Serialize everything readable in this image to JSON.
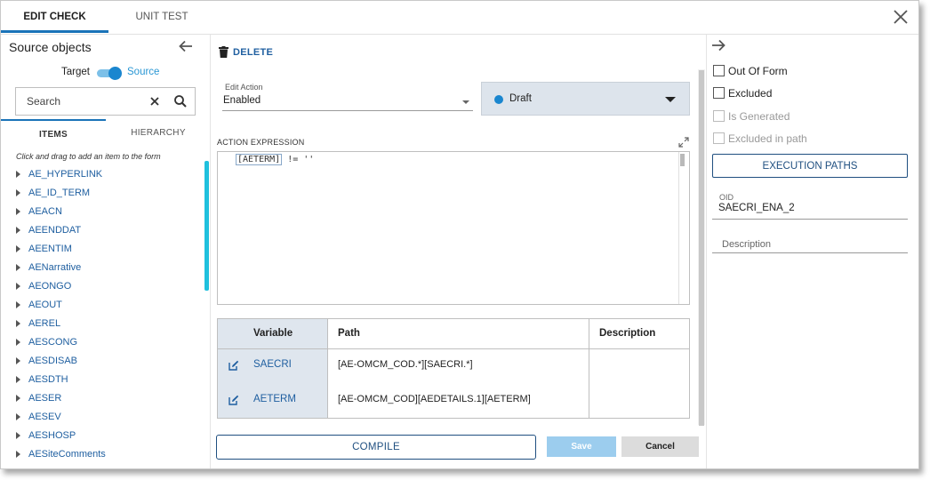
{
  "tabs": [
    {
      "label": "EDIT CHECK",
      "active": true
    },
    {
      "label": "UNIT TEST",
      "active": false
    }
  ],
  "left": {
    "title": "Source objects",
    "toggle": {
      "left_label": "Target",
      "right_label": "Source",
      "value": "Source"
    },
    "search": {
      "placeholder": "Search",
      "value": ""
    },
    "subtabs": [
      {
        "label": "ITEMS",
        "active": true
      },
      {
        "label": "HIERARCHY",
        "active": false
      }
    ],
    "hint": "Click and drag to add an item to the form",
    "items": [
      "AE_HYPERLINK",
      "AE_ID_TERM",
      "AEACN",
      "AEENDDAT",
      "AEENTIM",
      "AENarrative",
      "AEONGO",
      "AEOUT",
      "AEREL",
      "AESCONG",
      "AESDISAB",
      "AESDTH",
      "AESER",
      "AESEV",
      "AESHOSP",
      "AESiteComments"
    ]
  },
  "main": {
    "delete_label": "DELETE",
    "edit_action": {
      "label": "Edit Action",
      "value": "Enabled"
    },
    "status": {
      "value": "Draft",
      "color": "#1a86cf"
    },
    "expression": {
      "label": "ACTION EXPRESSION",
      "token": "[AETERM]",
      "rest": " != ''"
    },
    "variables": {
      "headers": {
        "variable": "Variable",
        "path": "Path",
        "description": "Description"
      },
      "rows": [
        {
          "name": "SAECRI",
          "path": "[AE-OMCM_COD.*][SAECRI.*]",
          "description": ""
        },
        {
          "name": "AETERM",
          "path": "[AE-OMCM_COD][AEDETAILS.1][AETERM]",
          "description": ""
        }
      ]
    },
    "compile_label": "COMPILE",
    "save_label": "Save",
    "cancel_label": "Cancel"
  },
  "right": {
    "checkboxes": [
      {
        "label": "Out Of Form",
        "checked": false,
        "disabled": false
      },
      {
        "label": "Excluded",
        "checked": false,
        "disabled": false
      },
      {
        "label": "Is Generated",
        "checked": false,
        "disabled": true
      },
      {
        "label": "Excluded in path",
        "checked": false,
        "disabled": true
      }
    ],
    "execution_paths_label": "EXECUTION PATHS",
    "oid": {
      "label": "OID",
      "value": "SAECRI_ENA_2"
    },
    "description": {
      "label": "Description",
      "value": ""
    }
  },
  "colors": {
    "accent": "#1a73b8",
    "link": "#1f5fa0",
    "scroll_highlight": "#1fc0dd"
  }
}
